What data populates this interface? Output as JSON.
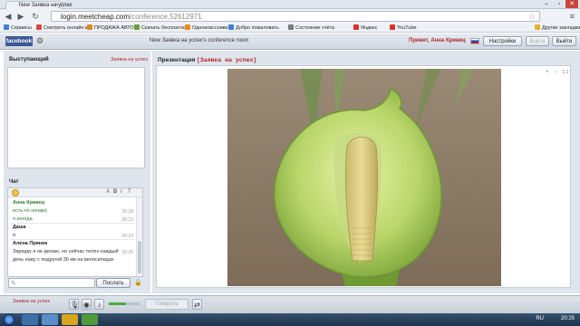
{
  "browser": {
    "tab_title": "New Заявка на успех",
    "tab_close": "×",
    "controls": {
      "minimize": "–",
      "maximize": "▫",
      "close": "✕"
    },
    "url_host": "login.meetcheap.com",
    "url_path": "/conference,52612971",
    "bookmarks": [
      {
        "label": "Сервисы",
        "color": "#3f7fd6"
      },
      {
        "label": "Смотреть онлайн в",
        "color": "#d84a3c"
      },
      {
        "label": "ПРОДАЖА АВТО",
        "color": "#e08a1c"
      },
      {
        "label": "Скачать бесплатно",
        "color": "#6b9f3a"
      },
      {
        "label": "Одноклассники",
        "color": "#f08a1c"
      },
      {
        "label": "Добро пожаловать",
        "color": "#3f7fd6"
      },
      {
        "label": "Состояние счёта",
        "color": "#7a7a7a"
      },
      {
        "label": "Яндекс",
        "color": "#d8332a"
      },
      {
        "label": "YouTube",
        "color": "#d8332a"
      },
      {
        "label": "Другие закладки",
        "color": "#e6b32e"
      }
    ]
  },
  "app": {
    "facebook_label": "facebook",
    "room_title": "New Заявка на успех's conference room",
    "greeting": "Привет, Анна Кривец",
    "buttons": {
      "settings": "Настройки",
      "enter": "Войти",
      "exit": "Выйти"
    }
  },
  "speaker_panel": {
    "title": "Выступающий",
    "right_label": "Заявка на успех"
  },
  "chat": {
    "title": "Чат",
    "tools": [
      "A",
      "B",
      "I",
      "T"
    ],
    "messages": [
      {
        "author": "Анна Кривец",
        "text": "",
        "time": "",
        "style": "green"
      },
      {
        "author": "",
        "text": "есть по ночам)",
        "time": "20:18",
        "style": "green"
      },
      {
        "author": "",
        "text": "я иногда",
        "time": "20:23",
        "style": "green"
      },
      {
        "author": "Даша",
        "text": "",
        "time": "",
        "style": "dark"
      },
      {
        "author": "",
        "text": "я",
        "time": "20:23",
        "style": "dark"
      },
      {
        "author": "Алена Пряник",
        "text": "",
        "time": "",
        "style": "dark"
      },
      {
        "author": "",
        "text": "Зарядку я не делаю, но сейчас тепло каждый",
        "time": "20:25",
        "style": "dark"
      },
      {
        "author": "",
        "text": "день езжу с подругой 30 км на велосипедах",
        "time": "",
        "style": "dark"
      }
    ],
    "send_label": "Послать"
  },
  "presentation": {
    "label": "Презентация",
    "title": "[Заявка на успех]",
    "zoom": [
      "+",
      "−",
      "1:1"
    ]
  },
  "bottom": {
    "label": "Заявка на успех",
    "talk_label": "Говорить",
    "volume_level": 0.55
  },
  "taskbar": {
    "lang": "RU",
    "time": "20:25"
  }
}
